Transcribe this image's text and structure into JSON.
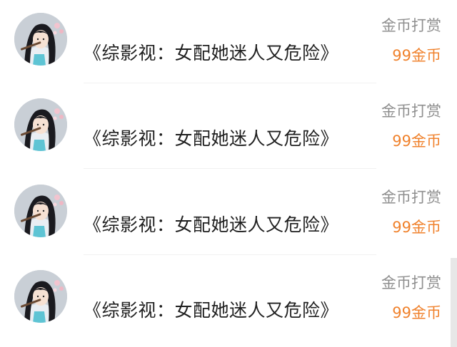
{
  "items": [
    {
      "avatar_icon": "anime-girl-flute-avatar",
      "title": "《综影视：女配她迷人又危险》",
      "reward_label": "金币打赏",
      "reward_amount": "99金币"
    },
    {
      "avatar_icon": "anime-girl-flute-avatar",
      "title": "《综影视：女配她迷人又危险》",
      "reward_label": "金币打赏",
      "reward_amount": "99金币"
    },
    {
      "avatar_icon": "anime-girl-flute-avatar",
      "title": "《综影视：女配她迷人又危险》",
      "reward_label": "金币打赏",
      "reward_amount": "99金币"
    },
    {
      "avatar_icon": "anime-girl-flute-avatar",
      "title": "《综影视：女配她迷人又危险》",
      "reward_label": "金币打赏",
      "reward_amount": "99金币"
    }
  ],
  "colors": {
    "title": "#1f1f1f",
    "reward_label": "#8f8f8f",
    "reward_amount": "#f0822d",
    "divider": "#f1f1f1"
  }
}
